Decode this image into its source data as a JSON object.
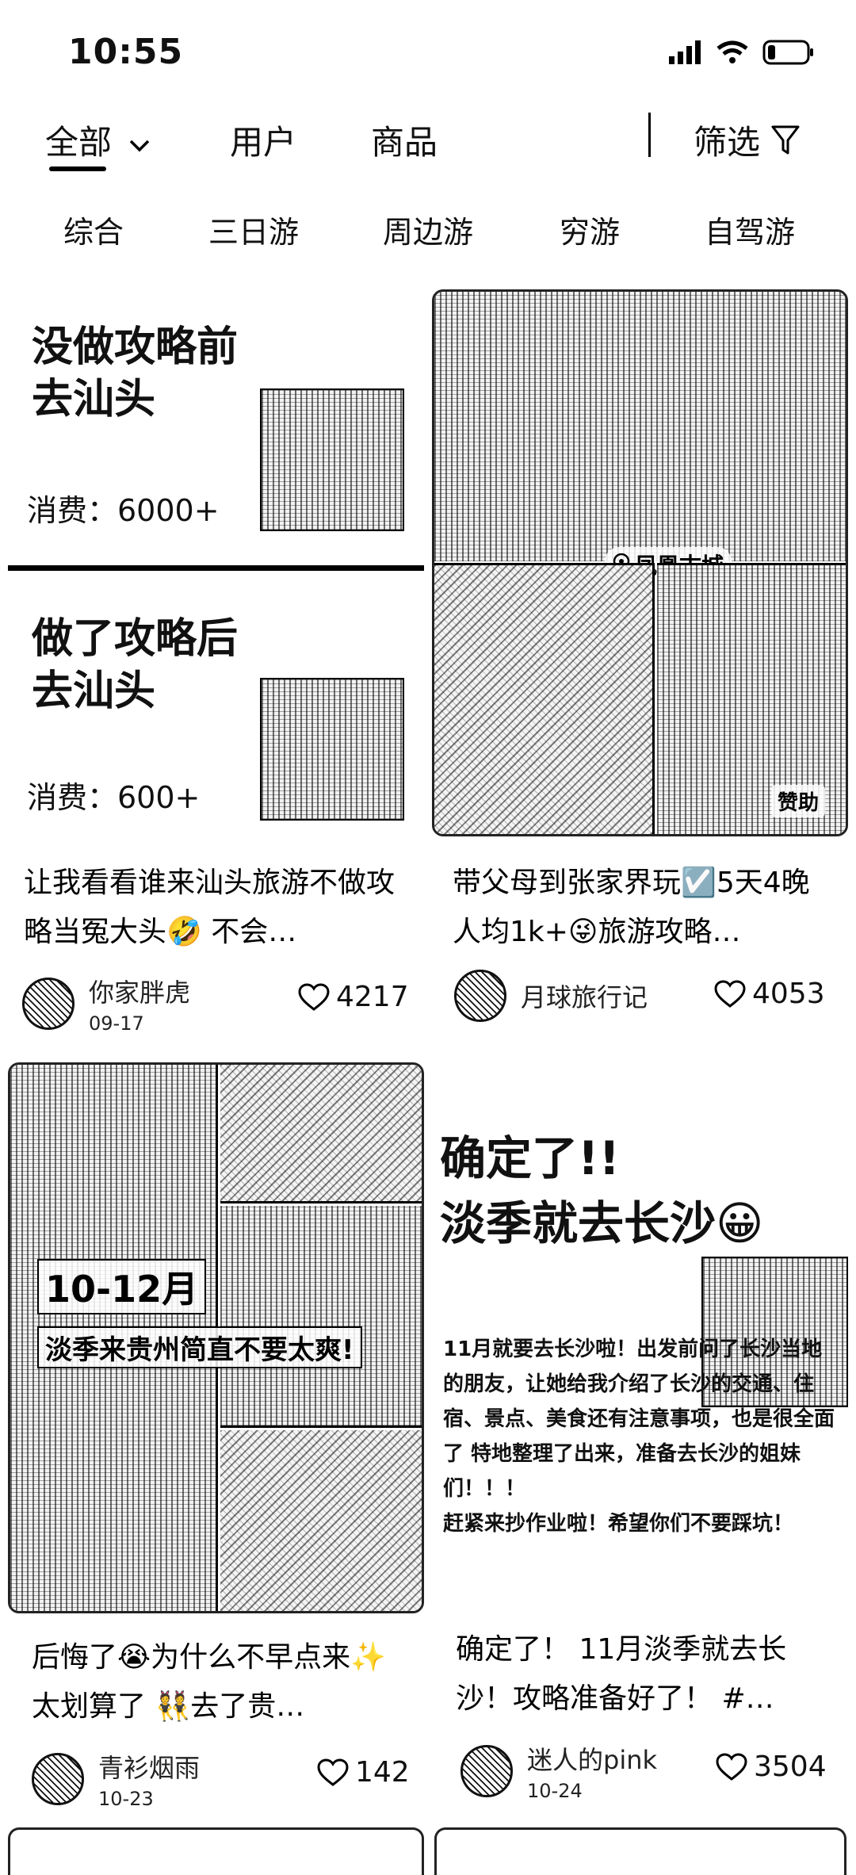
{
  "status": {
    "time": "10:55"
  },
  "tabs": {
    "all": "全部",
    "users": "用户",
    "products": "商品",
    "filter": "筛选"
  },
  "categories": [
    "综合",
    "三日游",
    "周边游",
    "穷游",
    "自驾游"
  ],
  "cards": [
    {
      "cover": {
        "top_title": "没做攻略前\n去汕头",
        "top_cost": "消费：6000+",
        "bottom_title": "做了攻略后\n去汕头",
        "bottom_cost": "消费：600+"
      },
      "title": "让我看看谁来汕头旅游不做攻略当冤大头🤣 不会…",
      "author": "你家胖虎",
      "date": "09-17",
      "likes": "4217"
    },
    {
      "cover": {
        "place_tag": "凤凰古城",
        "sponsor": "赞助"
      },
      "title": "带父母到张家界玩☑️5天4晚人均1k+😜旅游攻略…",
      "author": "月球旅行记",
      "date": "",
      "likes": "4053"
    },
    {
      "cover": {
        "months": "10-12月",
        "headline": "淡季来贵州简直不要太爽!"
      },
      "title": "后悔了😭为什么不早点来✨太划算了 👯去了贵…",
      "author": "青衫烟雨",
      "date": "10-23",
      "likes": "142"
    },
    {
      "cover": {
        "headline": "确定了!!\n淡季就去长沙😀",
        "body": "11月就要去长沙啦！出发前问了长沙当地的朋友，让她给我介绍了长沙的交通、住宿、景点、美食还有注意事项，也是很全面了 特地整理了出来，准备去长沙的姐妹们！！！\n赶紧来抄作业啦！希望你们不要踩坑！"
      },
      "title": "确定了！ 11月淡季就去长沙！攻略准备好了！ #…",
      "author": "迷人的pink",
      "date": "10-24",
      "likes": "3504"
    }
  ]
}
